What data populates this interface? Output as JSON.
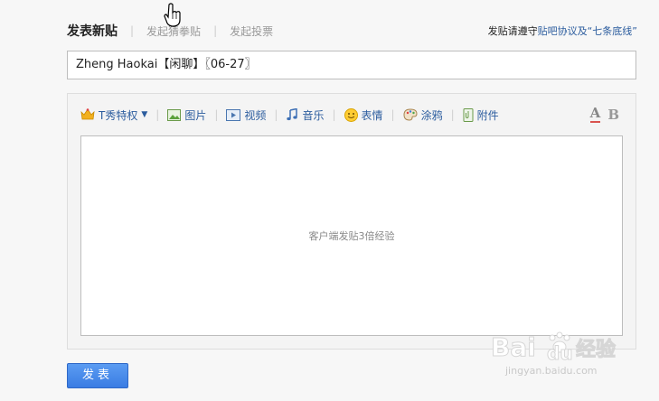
{
  "tabs": [
    {
      "label": "发表新贴",
      "active": true
    },
    {
      "label": "发起猜拳贴",
      "active": false
    },
    {
      "label": "发起投票",
      "active": false
    }
  ],
  "notice": {
    "prefix": "发贴请遵守",
    "link": "贴吧协议及“七条底线”"
  },
  "title_input": {
    "value": "Zheng Haokai【闲聊】〖06-27〗"
  },
  "toolbar": [
    {
      "label": "T秀特权",
      "icon": "crown-icon"
    },
    {
      "label": "图片",
      "icon": "image-icon"
    },
    {
      "label": "视频",
      "icon": "video-icon"
    },
    {
      "label": "音乐",
      "icon": "music-icon"
    },
    {
      "label": "表情",
      "icon": "smiley-icon"
    },
    {
      "label": "涂鸦",
      "icon": "palette-icon"
    },
    {
      "label": "附件",
      "icon": "attachment-icon"
    }
  ],
  "format": {
    "font_color": "A",
    "bold": "B"
  },
  "editor": {
    "placeholder": "客户端发贴3倍经验"
  },
  "submit": {
    "label": "发表"
  },
  "watermark": {
    "brand": "Bai",
    "brand2": "du",
    "cn": "经验",
    "url": "jingyan.baidu.com"
  },
  "colors": {
    "link": "#2b5c9e",
    "button": "#3a7ce3"
  }
}
